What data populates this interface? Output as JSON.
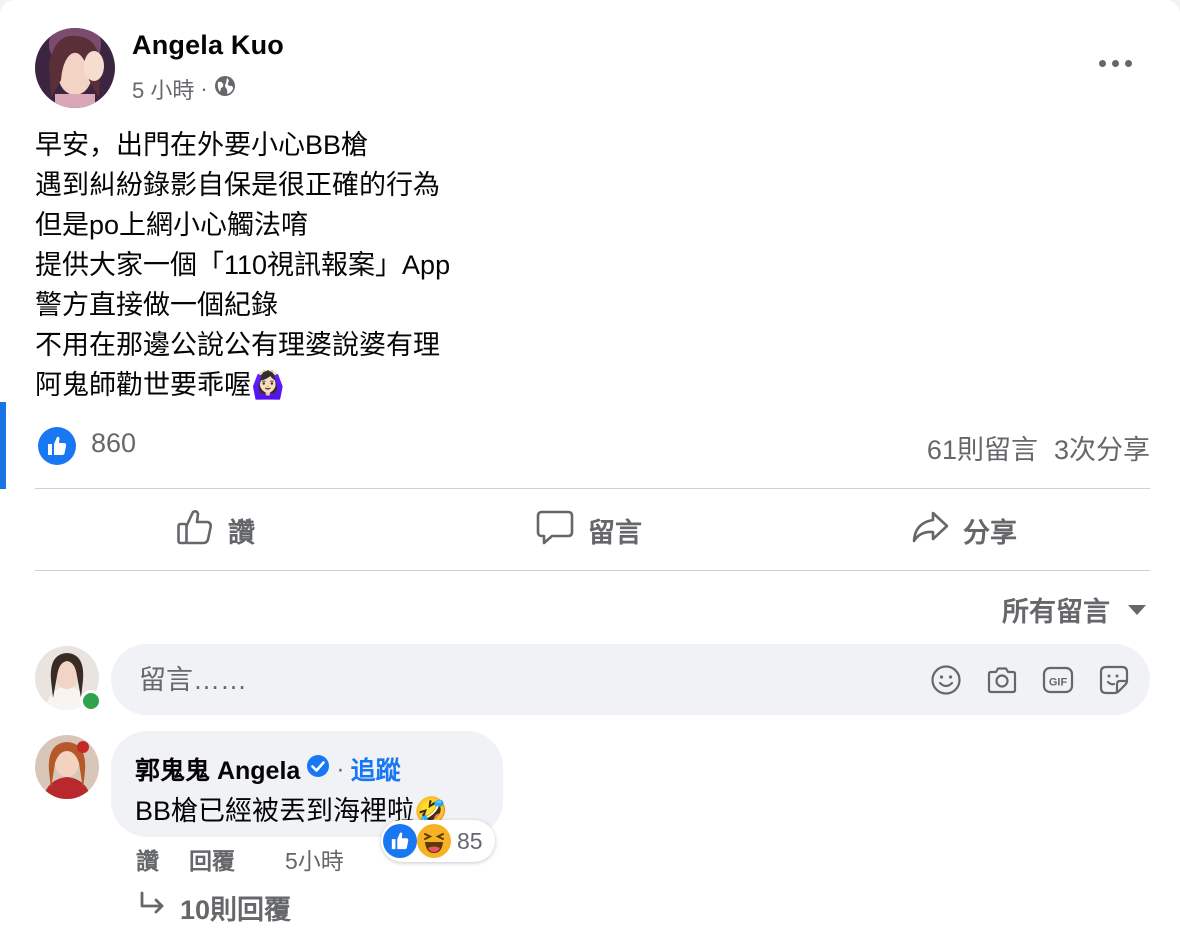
{
  "post": {
    "author": "Angela Kuo",
    "time": "5 小時",
    "dot": "·",
    "body_lines": [
      "早安，出門在外要小心BB槍",
      "遇到糾紛錄影自保是很正確的行為",
      "但是po上網小心觸法唷",
      "提供大家一個「110視訊報案」App",
      "警方直接做一個紀錄",
      "不用在那邊公說公有理婆說婆有理",
      "阿鬼師勸世要乖喔🙆🏻‍♀️"
    ],
    "like_count": "860",
    "comments_count": "61則留言",
    "shares_count": "3次分享"
  },
  "actions": {
    "like": "讚",
    "comment": "留言",
    "share": "分享"
  },
  "sort": {
    "label": "所有留言"
  },
  "composer": {
    "placeholder": "留言……"
  },
  "comment": {
    "author": "郭鬼鬼 Angela",
    "dot": "·",
    "follow": "追蹤",
    "text": "BB槍已經被丟到海裡啦🤣",
    "reaction_count": "85",
    "like": "讚",
    "reply": "回覆",
    "time": "5小時",
    "view_replies": "10則回覆"
  },
  "colors": {
    "accent": "#1877f2",
    "secondary_text": "#65676b",
    "online": "#31a24c"
  }
}
